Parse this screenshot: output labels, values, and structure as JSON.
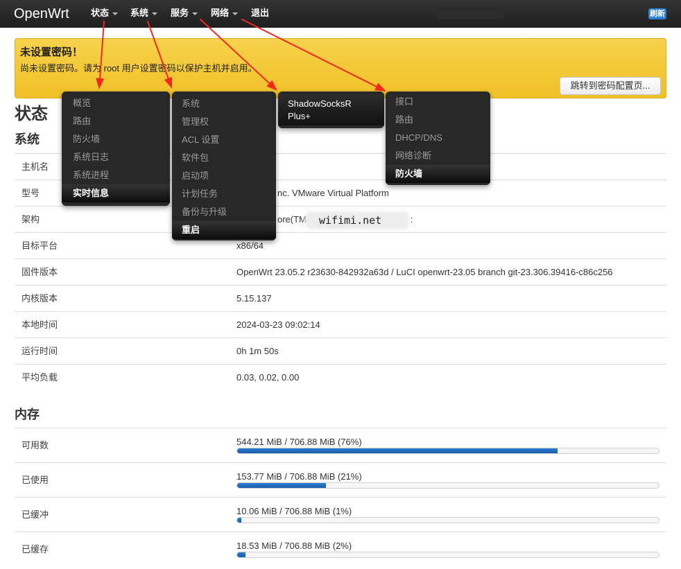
{
  "brand": "OpenWrt",
  "nav": {
    "status": "状态",
    "system": "系统",
    "services": "服务",
    "network": "网络",
    "logout": "退出",
    "refresh_badge": "刷新"
  },
  "warning": {
    "title": "未设置密码！",
    "text": "尚未设置密码。请为 root 用户设置密码以保护主机并启用。",
    "button": "跳转到密码配置页..."
  },
  "page_title": "状态",
  "system": {
    "heading": "系统",
    "rows": [
      {
        "label": "主机名"
      },
      {
        "label": "型号",
        "value": "nc. VMware Virtual Platform"
      },
      {
        "label": "架构",
        "value": "ore(TM",
        "watermark": "wifimi.net",
        "value_suffix": ":"
      },
      {
        "label": "目标平台",
        "value": "x86/64"
      },
      {
        "label": "固件版本",
        "value": "OpenWrt 23.05.2 r23630-842932a63d / LuCI openwrt-23.05 branch git-23.306.39416-c86c256"
      },
      {
        "label": "内核版本",
        "value": "5.15.137"
      },
      {
        "label": "本地时间",
        "value": "2024-03-23 09:02:14"
      },
      {
        "label": "运行时间",
        "value": "0h 1m 50s"
      },
      {
        "label": "平均负载",
        "value": "0.03, 0.02, 0.00"
      }
    ]
  },
  "memory": {
    "heading": "内存",
    "rows": [
      {
        "label": "可用数",
        "text": "544.21 MiB / 706.88 MiB (76%)",
        "percent": 76
      },
      {
        "label": "已使用",
        "text": "153.77 MiB / 706.88 MiB (21%)",
        "percent": 21
      },
      {
        "label": "已缓冲",
        "text": "10.06 MiB / 706.88 MiB (1%)",
        "percent": 1
      },
      {
        "label": "已缓存",
        "text": "18.53 MiB / 706.88 MiB (2%)",
        "percent": 2
      }
    ]
  },
  "menus": {
    "status": {
      "items": [
        "概览",
        "路由",
        "防火墙",
        "系统日志",
        "系统进程",
        "实时信息"
      ],
      "active_index": 5
    },
    "system": {
      "items": [
        "系统",
        "管理权",
        "ACL 设置",
        "软件包",
        "启动项",
        "计划任务",
        "备份与升级",
        "重启"
      ],
      "active_index": 7
    },
    "services": {
      "items": [
        "ShadowSocksR Plus+"
      ]
    },
    "network": {
      "items": [
        "接口",
        "路由",
        "DHCP/DNS",
        "网络诊断",
        "防火墙"
      ],
      "active_index": 4
    }
  },
  "colors": {
    "navbar": "#222222",
    "accent": "#2f80d1",
    "warning": "#f2c230",
    "progress_fill": "#1f6fc5",
    "annotation": "#f22a1c"
  },
  "icons": {
    "menu_caret": "chevron-down-icon",
    "annotation": "red-arrow-icon"
  }
}
